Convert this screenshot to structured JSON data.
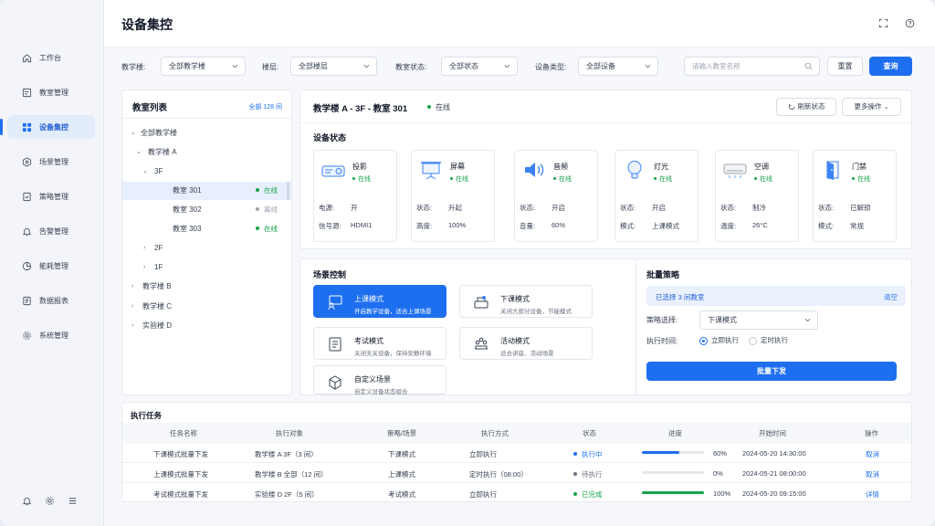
{
  "sidebar": {
    "items": [
      {
        "label": "工作台",
        "icon": "home-icon"
      },
      {
        "label": "教室管理",
        "icon": "classroom-icon"
      },
      {
        "label": "设备集控",
        "icon": "grid-icon",
        "active": true
      },
      {
        "label": "场景管理",
        "icon": "scene-icon"
      },
      {
        "label": "策略管理",
        "icon": "policy-icon"
      },
      {
        "label": "告警管理",
        "icon": "bell-icon"
      },
      {
        "label": "能耗管理",
        "icon": "chart-pie-icon"
      },
      {
        "label": "数据报表",
        "icon": "report-icon"
      },
      {
        "label": "系统管理",
        "icon": "gear-icon"
      }
    ]
  },
  "header": {
    "title": "设备集控"
  },
  "filters": {
    "building_label": "教学楼:",
    "building_value": "全部教学楼",
    "floor_label": "楼层:",
    "floor_value": "全部楼层",
    "status_label": "教室状态:",
    "status_value": "全部状态",
    "type_label": "设备类型:",
    "type_value": "全部设备",
    "search_placeholder": "请输入教室名称",
    "reset_label": "重置",
    "query_label": "查询"
  },
  "room_list": {
    "title": "教室列表",
    "total": "全部 128 间",
    "root": "全部教学楼",
    "building_a": "教学楼 A",
    "floor_3f": "3F",
    "rooms": [
      {
        "name": "教室 301",
        "status": "在线"
      },
      {
        "name": "教室 302",
        "status": "离线"
      },
      {
        "name": "教室 303",
        "status": "在线"
      }
    ],
    "floor_2f": "2F",
    "floor_1f": "1F",
    "building_b": "教学楼 B",
    "building_c": "教学楼 C",
    "building_d": "实验楼 D"
  },
  "room_detail": {
    "title": "教学楼 A - 3F - 教室 301",
    "status": "在线",
    "refresh_label": "刷新状态",
    "more_label": "更多操作",
    "section_title": "设备状态",
    "devices": [
      {
        "name": "投影",
        "status": "在线",
        "k1": "电源:",
        "v1": "开",
        "k2": "信号源:",
        "v2": "HDMI1",
        "icon": "projector-icon"
      },
      {
        "name": "屏幕",
        "status": "在线",
        "k1": "状态:",
        "v1": "升起",
        "k2": "高度:",
        "v2": "100%",
        "icon": "screen-icon"
      },
      {
        "name": "音频",
        "status": "在线",
        "k1": "状态:",
        "v1": "开启",
        "k2": "音量:",
        "v2": "60%",
        "icon": "speaker-icon"
      },
      {
        "name": "灯光",
        "status": "在线",
        "k1": "状态:",
        "v1": "开启",
        "k2": "模式:",
        "v2": "上课模式",
        "icon": "bulb-icon"
      },
      {
        "name": "空调",
        "status": "在线",
        "k1": "状态:",
        "v1": "制冷",
        "k2": "温度:",
        "v2": "26°C",
        "icon": "aircon-icon"
      },
      {
        "name": "门禁",
        "status": "在线",
        "k1": "状态:",
        "v1": "已解锁",
        "k2": "模式:",
        "v2": "常规",
        "icon": "door-icon"
      }
    ]
  },
  "scene": {
    "title": "场景控制",
    "items": [
      {
        "name": "上课模式",
        "desc": "开启教学设备，适合上课场景",
        "icon": "teacher-icon"
      },
      {
        "name": "下课模式",
        "desc": "关闭大部分设备，节能模式",
        "icon": "break-icon"
      },
      {
        "name": "考试模式",
        "desc": "关闭无关设备，保持安静环境",
        "icon": "exam-icon"
      },
      {
        "name": "活动模式",
        "desc": "适合讲座、活动场景",
        "icon": "activity-icon"
      },
      {
        "name": "自定义场景",
        "desc": "自定义设备状态组合",
        "icon": "cube-icon"
      }
    ]
  },
  "batch": {
    "title": "批量策略",
    "selected": "已选择 3 间教室",
    "clear_label": "清空",
    "policy_label": "策略选择:",
    "policy_value": "下课模式",
    "exec_label": "执行时间:",
    "opt_now": "立即执行",
    "opt_timed": "定时执行",
    "submit_label": "批量下发"
  },
  "tasks": {
    "title": "执行任务",
    "columns": [
      "任务名称",
      "执行对象",
      "策略/场景",
      "执行方式",
      "状态",
      "进度",
      "开始时间",
      "操作"
    ],
    "rows": [
      {
        "name": "下课模式批量下发",
        "target": "教学楼 A 3F（3 间）",
        "policy": "下课模式",
        "mode": "立即执行",
        "status": "执行中",
        "progress": 60,
        "progress_text": "60%",
        "start": "2024-05-20 14:30:00",
        "action": "取消",
        "color": "#1e6ff0"
      },
      {
        "name": "上课模式批量下发",
        "target": "教学楼 B 全部（12 间）",
        "policy": "上课模式",
        "mode": "定时执行（08:00）",
        "status": "待执行",
        "progress": 0,
        "progress_text": "0%",
        "start": "2024-05-21 08:00:00",
        "action": "取消",
        "color": "#6b7280"
      },
      {
        "name": "考试模式批量下发",
        "target": "实验楼 D 2F（5 间）",
        "policy": "考试模式",
        "mode": "立即执行",
        "status": "已完成",
        "progress": 100,
        "progress_text": "100%",
        "start": "2024-05-20 09:15:00",
        "action": "详情",
        "color": "#16a34a"
      }
    ]
  },
  "colors": {
    "primary": "#1e6ff0",
    "online": "#16a34a",
    "offline": "#9ca3af"
  }
}
